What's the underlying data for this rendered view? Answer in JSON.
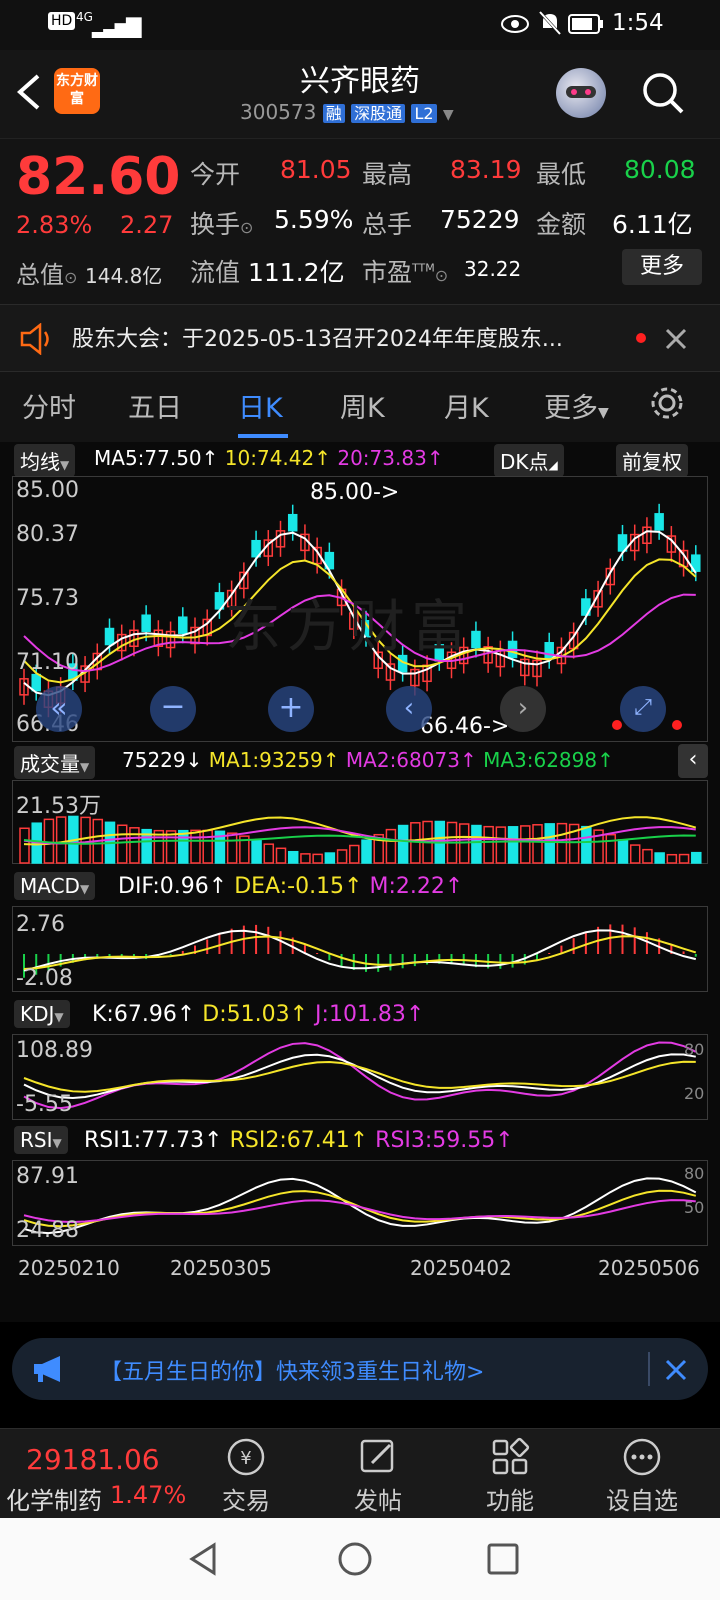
{
  "status_bar": {
    "network": "4G",
    "time": "1:54"
  },
  "header": {
    "logo": "东方财富",
    "stock_name": "兴齐眼药",
    "code": "300573",
    "tags": [
      "融",
      "深股通",
      "L2"
    ]
  },
  "quote": {
    "price": "82.60",
    "change_pct": "2.83%",
    "change": "2.27",
    "open_label": "今开",
    "open": "81.05",
    "high_label": "最高",
    "high": "83.19",
    "low_label": "最低",
    "low": "80.08",
    "turnover_label": "换手",
    "turnover": "5.59%",
    "volume_label": "总手",
    "volume": "75229",
    "amount_label": "金额",
    "amount": "6.11亿",
    "mcap_label": "总值",
    "mcap": "144.8亿",
    "float_label": "流值",
    "float": "111.2亿",
    "pe_label": "市盈",
    "pe_sup": "TTM",
    "pe": "32.22",
    "more_button": "更多"
  },
  "notice": {
    "text": "股东大会：于2025-05-13召开2024年年度股东..."
  },
  "tabs": [
    "分时",
    "五日",
    "日K",
    "周K",
    "月K",
    "更多"
  ],
  "active_tab": "日K",
  "kline": {
    "ma_selector": "均线",
    "ma5": "MA5:77.50",
    "ma10": "10:74.42",
    "ma20": "20:73.83",
    "dk_button": "DK点",
    "adjust_button": "前复权",
    "y_labels": [
      "85.00",
      "80.37",
      "75.73",
      "71.10",
      "66.46"
    ],
    "high_marker": "85.00->",
    "low_marker": "66.46->",
    "watermark": "东方财富"
  },
  "volume_panel": {
    "selector": "成交量",
    "current": "75229",
    "ma1": "MA1:93259",
    "ma2": "MA2:68073",
    "ma3": "MA3:62898",
    "y_label": "21.53万"
  },
  "macd_panel": {
    "selector": "MACD",
    "dif": "DIF:0.96",
    "dea": "DEA:-0.15",
    "m": "M:2.22",
    "y_top": "2.76",
    "y_bottom": "-2.08"
  },
  "kdj_panel": {
    "selector": "KDJ",
    "k": "K:67.96",
    "d": "D:51.03",
    "j": "J:101.83",
    "y_top": "108.89",
    "y_bottom": "-5.55",
    "r_top": "80",
    "r_bottom": "20"
  },
  "rsi_panel": {
    "selector": "RSI",
    "rsi1": "RSI1:77.73",
    "rsi2": "RSI2:67.41",
    "rsi3": "RSI3:59.55",
    "y_top": "87.91",
    "y_bottom": "24.88",
    "r_top": "80",
    "r_bottom": "50"
  },
  "dates": [
    "20250210",
    "20250305",
    "20250402",
    "20250506"
  ],
  "banner": {
    "text": "【五月生日的你】快来领3重生日礼物>"
  },
  "bottom_bar": {
    "index_value": "29181.06",
    "index_name": "化学制药",
    "index_change": "1.47%",
    "items": [
      "交易",
      "发帖",
      "功能",
      "设自选"
    ]
  },
  "colors": {
    "up": "#ff3b3b",
    "down": "#19e6e6",
    "ma5": "#ffffff",
    "ma10": "#f5e52a",
    "ma20": "#e33be3"
  },
  "chart_data": {
    "type": "candlestick",
    "y_range": [
      66.46,
      85.0
    ],
    "max_point": 85.0,
    "min_point": 66.46
  }
}
